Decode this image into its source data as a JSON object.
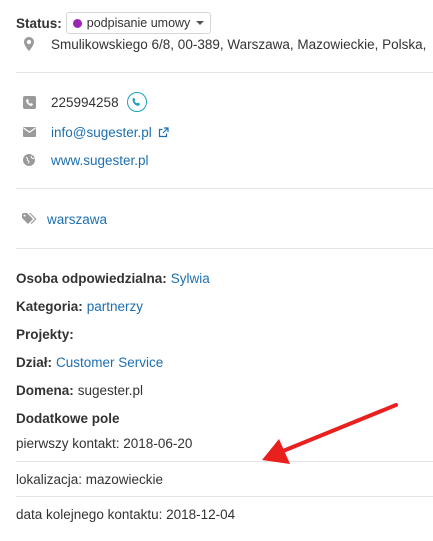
{
  "status": {
    "label": "Status:",
    "value": "podpisanie umowy",
    "dot_color": "#9b26b6"
  },
  "address": "Smulikowskiego 6/8, 00-389, Warszawa, Mazowieckie, Polska,",
  "contact": {
    "phone": "225994258",
    "email": "info@sugester.pl",
    "website": "www.sugester.pl"
  },
  "tag": "warszawa",
  "fields": {
    "responsible_label": "Osoba odpowiedzialna:",
    "responsible_value": "Sylwia",
    "category_label": "Kategoria:",
    "category_value": "partnerzy",
    "projects_label": "Projekty:",
    "department_label": "Dział:",
    "department_value": "Customer Service",
    "domain_label": "Domena:",
    "domain_value": "sugester.pl"
  },
  "extra": {
    "heading": "Dodatkowe pole",
    "items": [
      "pierwszy kontakt: 2018-06-20",
      "lokalizacja: mazowieckie",
      "data kolejnego kontaktu: 2018-12-04"
    ]
  },
  "colors": {
    "link": "#1d6fb0",
    "icon": "#9a9a9a",
    "call": "#1ba2bd",
    "arrow": "#e8211f"
  }
}
